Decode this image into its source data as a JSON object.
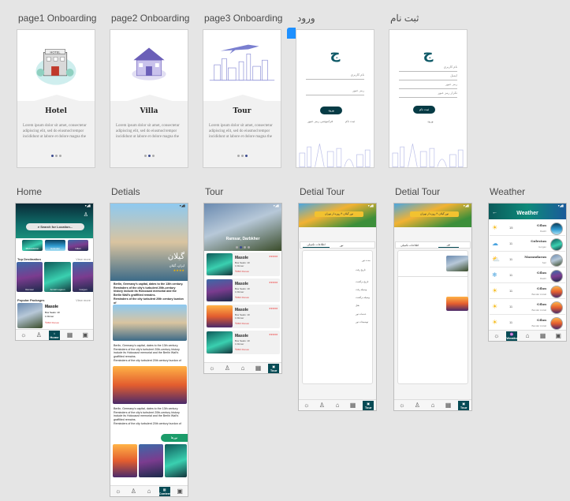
{
  "boards": {
    "page1": {
      "label": "page1 Onboarding",
      "title": "Hotel",
      "body": "Lorem ipsum dolor sit amet, consectetur adipiscing elit, sed do eiusmod tempor incididunt ut labore et dolore magna the"
    },
    "page2": {
      "label": "page2 Onboarding",
      "title": "Villa",
      "body": "Lorem ipsum dolor sit amet, consectetur adipiscing elit, sed do eiusmod tempor incididunt ut labore et dolore magna the"
    },
    "page3": {
      "label": "page3 Onboarding",
      "title": "Tour",
      "body": "Lorem ipsum dolor sit amet, consectetur adipiscing elit, sed do eiusmod tempor incididunt ut labore et dolore magna the"
    },
    "login": {
      "label": "ورود",
      "logo": "ج",
      "field_user": "نام کاربری",
      "field_pass": "رمز عبور",
      "button": "ورود",
      "link_signup": "ثبت نام",
      "link_forgot": "فراموشی رمز عبور"
    },
    "signup": {
      "label": "ثبت نام",
      "logo": "ج",
      "field_name": "نام کاربری",
      "field_email": "ایمیل",
      "field_pass": "رمز عبور",
      "field_repeat": "تکرار رمز عبور",
      "button": "ثبت نام",
      "link_login": "ورود"
    },
    "home": {
      "label": "Home",
      "search_placeholder": "Search for Location...",
      "chips": [
        "Mazandaran",
        "Golestan",
        "Gilan"
      ],
      "top_dest": "Top Destination",
      "view_more": "View more",
      "destinations": [
        "Ramsar",
        "Anzali Lagoon",
        "Gorgan"
      ],
      "popular": "Popular Packages",
      "pkg_title": "Masole",
      "pkg_lines": [
        "Bus Seats: 10",
        "1 Dinner"
      ],
      "pkg_price": "₹450/ Person"
    },
    "details": {
      "label": "Detials",
      "place": "گیلان",
      "place_sub": "ایران، گیلان",
      "rating": "★★★★",
      "para1": "Berlin, Germany's capital, dates to the 13th century. Reminders of the city's turbulent 20th-century history include its Holocaust memorial and the Berlin Wall's graffitied remains.",
      "para2": "Reminders of the city turbulent 20th century burdon of",
      "para3": "Berlin, Germany's capital, dates to the 13th century. Reminders of the city's turbulent 20th-century history include its Holocaust memorial and the Berlin Wall's graffitied remains.",
      "para4": "Reminders of the city turbulent 20th century burdon of",
      "para5": "Berlin, Germany's capital, dates to the 13th century. Reminders of the city's turbulent 20th-century history include its Holocaust memorial and the Berlin Wall's graffitied remains.",
      "para6": "Reminders of the city turbulent 20th century burdon of",
      "book_button": "تورها",
      "tab_active": "Content"
    },
    "tour": {
      "label": "Tour",
      "hero_caption": "Ramsar, Darbkher",
      "card_title": "Masole",
      "card_lines": [
        "Bus Seats: 10",
        "1 Dinner"
      ],
      "card_price": "₹450/ Person",
      "stars": "★★★★★",
      "tab_active": "Tour"
    },
    "detail_tour1": {
      "label": "Detial Tour",
      "banner_text": "تور گیلان ۴ روزه از تهران",
      "tab_info": "اطلاعات تکمیلی",
      "tab_tour": "تور",
      "rows": [
        "مدت تور",
        "تاریخ رفت",
        "تاریخ برگشت",
        "وسیله رفت",
        "وسیله برگشت",
        "هتل",
        "خدمات تور",
        "توضیحات تور"
      ],
      "tab_active": "Tour"
    },
    "detail_tour2": {
      "label": "Detial Tour",
      "banner_text": "تور گیلان ۴ روزه از تهران",
      "tab_info": "اطلاعات تکمیلی",
      "tab_tour": "تور",
      "tab_active": "Tour"
    },
    "weather": {
      "label": "Weather",
      "title": "Weather",
      "back": "←",
      "rows": [
        {
          "icon": "☀",
          "temp": "15",
          "name": "Gilan",
          "sub": "Rasht"
        },
        {
          "icon": "☁",
          "temp": "11",
          "name": "Golestan",
          "sub": "Gorgan"
        },
        {
          "icon": "⛅",
          "temp": "11",
          "name": "Mazandaran",
          "sub": "Sari"
        },
        {
          "icon": "❄",
          "temp": "11",
          "name": "Gilan",
          "sub": "Rasht"
        },
        {
          "icon": "☀",
          "temp": "11",
          "name": "Gilan",
          "sub": "Bandar Anzali"
        },
        {
          "icon": "☀",
          "temp": "11",
          "name": "Gilan",
          "sub": "Bandar Anzali"
        },
        {
          "icon": "☀",
          "temp": "11",
          "name": "Gilan",
          "sub": "Bandar Anzali"
        }
      ],
      "tab_active": "Weather"
    }
  }
}
